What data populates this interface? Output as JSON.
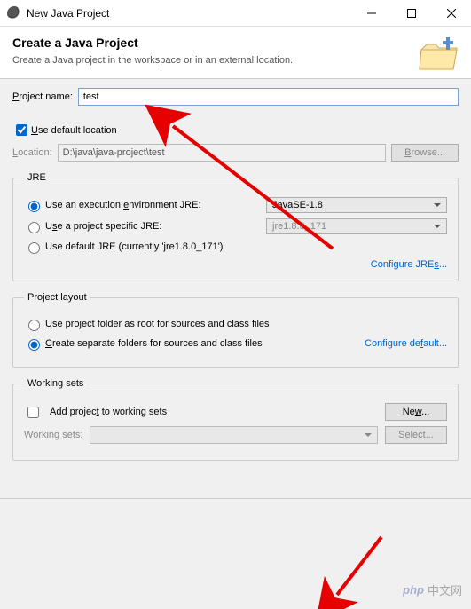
{
  "titlebar": {
    "title": "New Java Project"
  },
  "header": {
    "title": "Create a Java Project",
    "subtitle": "Create a Java project in the workspace or in an external location."
  },
  "project_name": {
    "label": "Project name:",
    "value": "test"
  },
  "default_location": {
    "checked": true,
    "label": "Use default location"
  },
  "location": {
    "label_pre": "L",
    "label_rest": "ocation:",
    "value": "D:\\java\\java-project\\test",
    "browse": "Browse..."
  },
  "jre": {
    "legend": "JRE",
    "opt_env": {
      "label": "Use an execution environment JRE:",
      "value": "JavaSE-1.8"
    },
    "opt_proj": {
      "label": "Use a project specific JRE:",
      "value": "jre1.8.0_171"
    },
    "opt_default": {
      "label": "Use default JRE (currently 'jre1.8.0_171')"
    },
    "configure": "Configure JREs..."
  },
  "layout": {
    "legend": "Project layout",
    "opt_root": "Use project folder as root for sources and class files",
    "opt_separate": "Create separate folders for sources and class files",
    "configure": "Configure default..."
  },
  "working_sets": {
    "legend": "Working sets",
    "add_label": "Add project to working sets",
    "new_btn": "New...",
    "label": "Working sets:",
    "select_btn": "Select..."
  },
  "watermark": {
    "php": "php",
    "cn": "中文网"
  }
}
